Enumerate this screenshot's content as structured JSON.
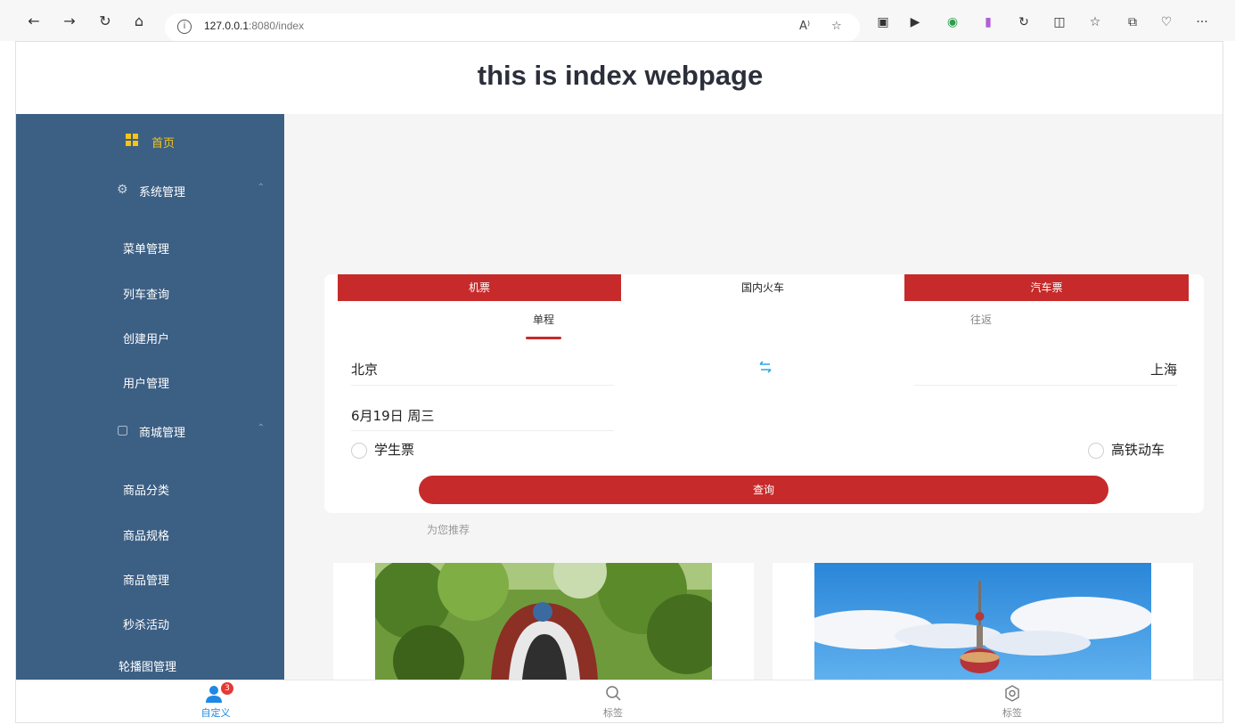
{
  "browser": {
    "url_host": "127.0.0.1",
    "url_rest": ":8080/index",
    "read_aloud": "A⁾",
    "more": "···"
  },
  "page": {
    "title": "this is index webpage"
  },
  "sidebar": {
    "items": [
      {
        "label": "首页",
        "icon": "grid-icon",
        "type": "home"
      },
      {
        "label": "系统管理",
        "icon": "gear-icon",
        "type": "group"
      },
      {
        "label": "菜单管理",
        "type": "sub"
      },
      {
        "label": "列车查询",
        "type": "sub"
      },
      {
        "label": "创建用户",
        "type": "sub"
      },
      {
        "label": "用户管理",
        "type": "sub"
      },
      {
        "label": "商城管理",
        "icon": "shop-icon",
        "type": "group"
      },
      {
        "label": "商品分类",
        "type": "sub"
      },
      {
        "label": "商品规格",
        "type": "sub"
      },
      {
        "label": "商品管理",
        "type": "sub"
      },
      {
        "label": "秒杀活动",
        "type": "sub"
      },
      {
        "label": "轮播图管理",
        "type": "sub"
      }
    ]
  },
  "booking": {
    "tabs": [
      "机票",
      "国内火车",
      "汽车票"
    ],
    "active_tab": "国内火车",
    "subtabs": [
      "单程",
      "往返"
    ],
    "active_subtab": "单程",
    "from": "北京",
    "to": "上海",
    "date": "6月19日 周三",
    "option_student": "学生票",
    "option_highspeed": "高铁动车",
    "query_label": "查询"
  },
  "recommend": {
    "label": "为您推荐"
  },
  "bottombar": {
    "items": [
      {
        "label": "自定义",
        "icon": "user-icon",
        "badge": "3",
        "active": true
      },
      {
        "label": "标签",
        "icon": "search-icon",
        "active": false
      },
      {
        "label": "标签",
        "icon": "settings-icon",
        "active": false
      }
    ]
  },
  "colors": {
    "sidebar_bg": "#3c5f84",
    "accent_red": "#c62a2a",
    "active_blue": "#1e88e5",
    "home_yellow": "#f5c518"
  }
}
